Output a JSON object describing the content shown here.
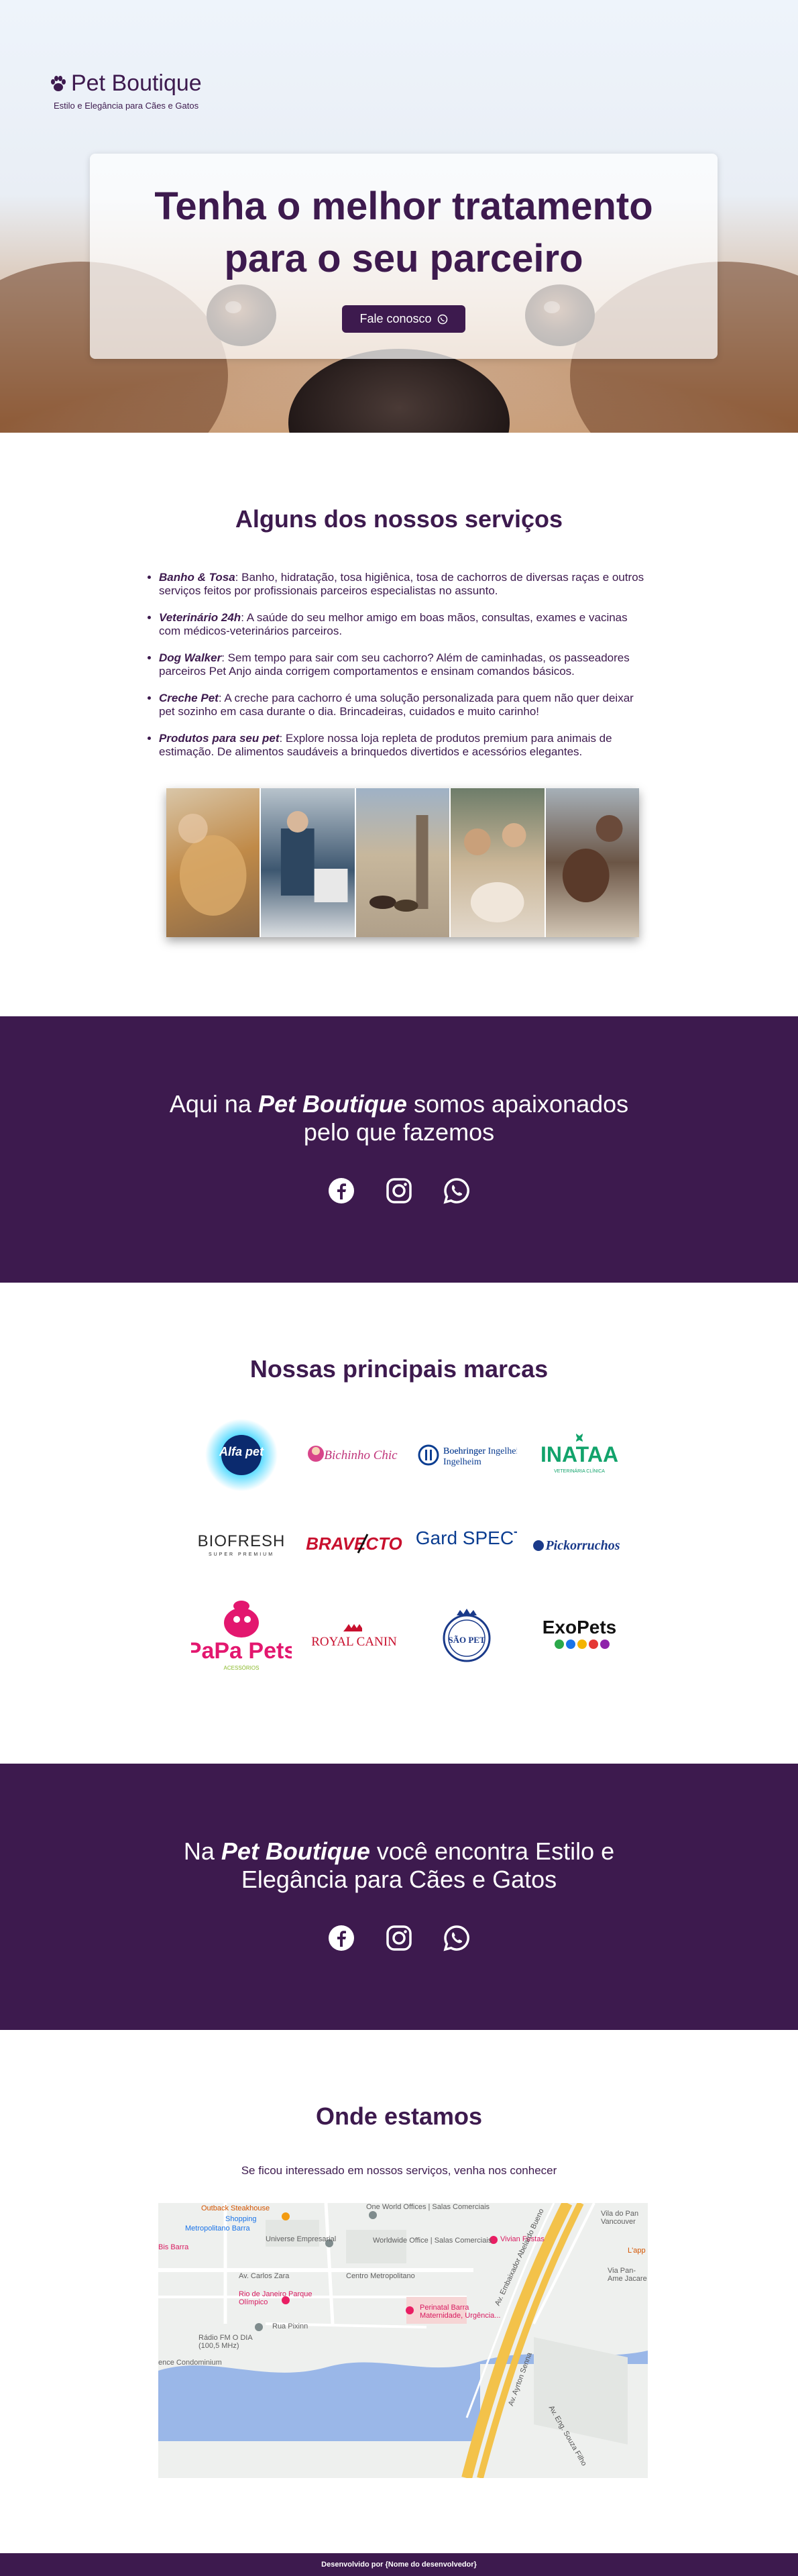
{
  "brand": {
    "title": "Pet Boutique",
    "subtitle": "Estilo e Elegância para Cães e Gatos",
    "icon": "paw-icon"
  },
  "hero": {
    "title": "Tenha o melhor tratamento para o seu parceiro",
    "cta_label": "Fale conosco",
    "cta_icon": "whatsapp-icon"
  },
  "services": {
    "title": "Alguns dos nossos serviços",
    "items": [
      {
        "name": "Banho & Tosa",
        "desc": ": Banho, hidratação, tosa higiênica, tosa de cachorros de diversas raças e outros serviços feitos por profissionais parceiros especialistas no assunto."
      },
      {
        "name": "Veterinário 24h",
        "desc": ": A saúde do seu melhor amigo em boas mãos, consultas, exames e vacinas com médicos-veterinários parceiros."
      },
      {
        "name": "Dog Walker",
        "desc": ": Sem tempo para sair com seu cachorro? Além de caminhadas, os passeadores parceiros Pet Anjo ainda corrigem comportamentos e ensinam comandos básicos."
      },
      {
        "name": "Creche Pet",
        "desc": ": A creche para cachorro é uma solução personalizada para quem não quer deixar pet sozinho em casa durante o dia. Brincadeiras, cuidados e muito carinho!"
      },
      {
        "name": "Produtos para seu pet",
        "desc": ": Explore nossa loja repleta de produtos premium para animais de estimação. De alimentos saudáveis a brinquedos divertidos e acessórios elegantes."
      }
    ]
  },
  "band1": {
    "prefix": "Aqui na ",
    "brand": "Pet Boutique",
    "suffix": " somos apaixonados pelo que fazemos"
  },
  "band2": {
    "prefix": "Na ",
    "brand": "Pet Boutique",
    "suffix": " você encontra Estilo e Elegância para Cães e Gatos"
  },
  "socials": [
    "facebook-icon",
    "instagram-icon",
    "whatsapp-icon"
  ],
  "brands": {
    "title": "Nossas principais marcas",
    "logos": [
      "Alfa pet",
      "Bichinho Chic",
      "Boehringer Ingelheim",
      "INATAA",
      "BIOFRESH",
      "BRAVECTO",
      "NexGard SPECTRA",
      "Pickorruchos",
      "PaPa Pets",
      "ROYAL CANIN",
      "SÃO PET",
      "ExoPets"
    ],
    "subtexts": {
      "biofresh": "SUPER PREMIUM",
      "papapets": "ACESSÓRIOS",
      "inataa": "VETERINÁRIA CLÍNICA"
    }
  },
  "location": {
    "title": "Onde estamos",
    "subtitle": "Se ficou interessado em nossos serviços, venha nos conhecer",
    "map_labels": [
      "Outback Steakhouse",
      "One World Offices | Salas Comerciais",
      "Metropolitano Barra",
      "Universe Empresarial",
      "Worldwide Office | Salas Comerciais",
      "Vivian Festas",
      "Av. Carlos Zara",
      "Centro Metropolitano",
      "Rio de Janeiro Parque Olímpico",
      "Perinatal Barra Maternidade, Urgência...",
      "Rua Pixinn",
      "Rádio FM O DIA (100,5 MHz)",
      "Av. Embaixador Abelardo Bueno",
      "Av. Ayrton Senna",
      "Via Pan-Ame Jacare",
      "Bis Barra",
      "Shopping",
      "ence Condominium",
      "Av. Eng. Souza Filho",
      "Vila do Pan Vancouver",
      "L'app"
    ]
  },
  "footer": {
    "text": "Desenvolvido por {Nome do desenvolvedor}"
  },
  "colors": {
    "primary": "#3d1a4e",
    "white": "#ffffff"
  }
}
